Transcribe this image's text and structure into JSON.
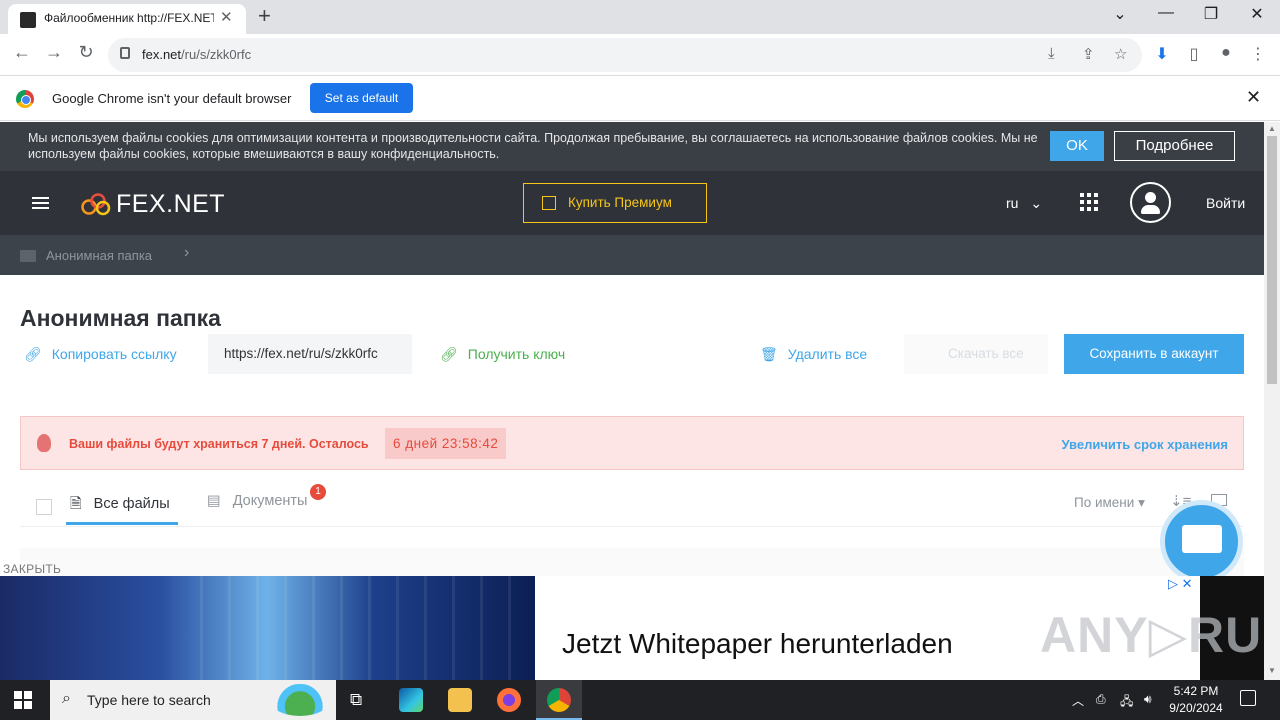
{
  "browser": {
    "tab_title": "Файлообменник http://FEX.NET",
    "tab_close": "✕",
    "new_tab": "+",
    "url_host": "fex.net",
    "url_path": "/ru/s/zkk0rfc",
    "back": "←",
    "forward": "→",
    "reload": "↻"
  },
  "infobar": {
    "message": "Google Chrome isn't your default browser",
    "button": "Set as default",
    "close": "✕"
  },
  "cookie": {
    "text": "Мы используем файлы cookies для оптимизации контента и производительности сайта. Продолжая пребывание, вы соглашаетесь на использование файлов cookies. Мы не используем файлы cookies, которые вмешиваются в вашу конфиденциальность.",
    "ok": "OK",
    "more": "Подробнее"
  },
  "header": {
    "logo": "FEX.NET",
    "premium": "Купить Премиум",
    "lang": "ru",
    "login": "Войти"
  },
  "breadcrumb": {
    "folder": "Анонимная папка",
    "chevron": "›"
  },
  "folder": {
    "title": "Анонимная папка",
    "copy_link": "Копировать ссылку",
    "share_url": "https://fex.net/ru/s/zkk0rfc",
    "get_key": "Получить ключ",
    "delete_all": "Удалить все",
    "download_all": "Скачать все",
    "save_to_account": "Сохранить в аккаунт"
  },
  "alert": {
    "message": "Ваши файлы будут храниться 7 дней. Осталось",
    "timer": "6 дней  23:58:42",
    "extend": "Увеличить срок хранения"
  },
  "file_tabs": {
    "all": "Все файлы",
    "docs": "Документы",
    "docs_badge": "1",
    "sort": "По имени",
    "sort_arrow": "▾"
  },
  "ad": {
    "close_label": "ЗАКРЫТЬ",
    "headline": "Jetzt Whitepaper herunterladen",
    "watermark": "ANY▷RUN"
  },
  "taskbar": {
    "search_placeholder": "Type here to search",
    "time": "5:42 PM",
    "date": "9/20/2024"
  }
}
